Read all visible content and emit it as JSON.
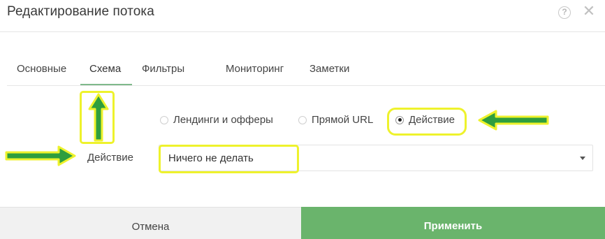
{
  "dialog": {
    "title": "Редактирование потока",
    "help_icon": "help-circle-icon",
    "help_glyph": "?",
    "close_icon": "close-icon",
    "close_glyph": "✕"
  },
  "tabs": [
    {
      "label": "Основные",
      "active": false
    },
    {
      "label": "Схема",
      "active": true
    },
    {
      "label": "Фильтры",
      "active": false
    },
    {
      "label": "Мониторинг",
      "active": false
    },
    {
      "label": "Заметки",
      "active": false
    }
  ],
  "schema_type": {
    "options": [
      {
        "label": "Лендинги и офферы",
        "checked": false
      },
      {
        "label": "Прямой URL",
        "checked": false
      },
      {
        "label": "Действие",
        "checked": true
      }
    ]
  },
  "action": {
    "label": "Действие",
    "selected": "Ничего не делать"
  },
  "footer": {
    "cancel_label": "Отмена",
    "apply_label": "Применить"
  },
  "annotations": {
    "highlight_color": "#eef22c",
    "arrow_color": "#2e9e3e"
  },
  "colors": {
    "apply_button": "#6ab46c",
    "tab_underline": "#7fb98b"
  }
}
